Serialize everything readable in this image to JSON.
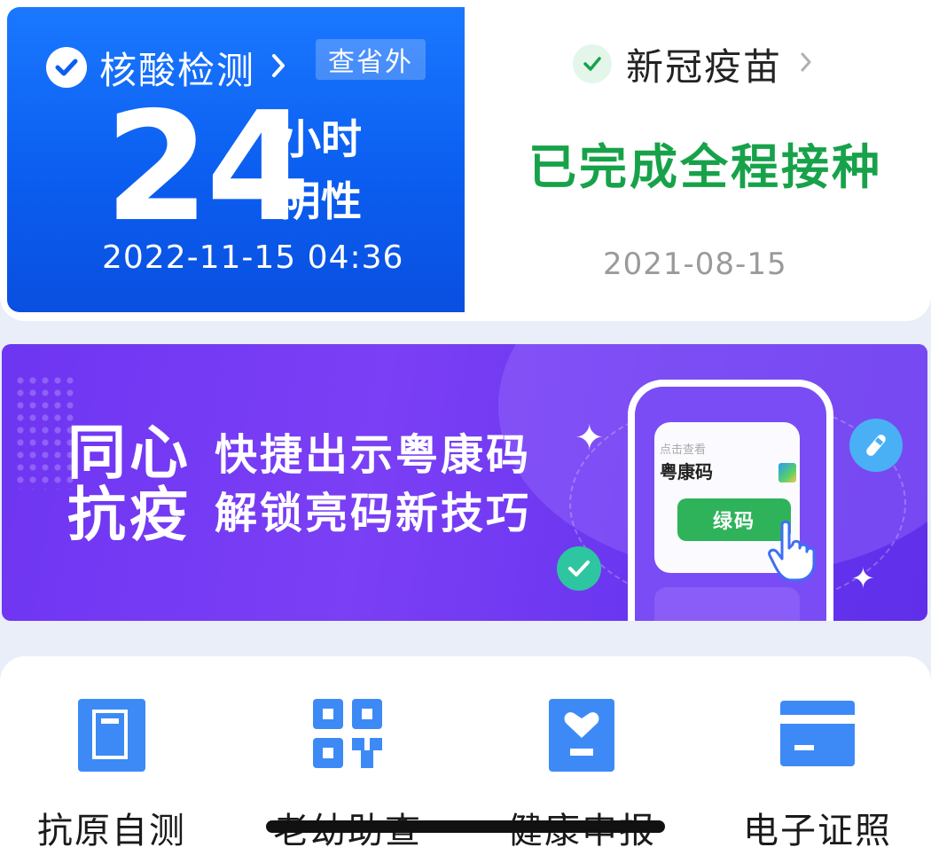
{
  "nucleic": {
    "title": "核酸检测",
    "tag": "查省外",
    "hours": "24",
    "unit": "小时",
    "result": "阴性",
    "datetime": "2022-11-15 04:36"
  },
  "vaccine": {
    "title": "新冠疫苗",
    "status": "已完成全程接种",
    "date": "2021-08-15"
  },
  "banner": {
    "big_line1": "同心",
    "big_line2": "抗疫",
    "line1": "快捷出示粤康码",
    "line2": "解锁亮码新技巧",
    "phone_small": "点击查看",
    "phone_title": "粤康码",
    "phone_button": "绿码"
  },
  "services": [
    {
      "label": "抗原自测",
      "icon": "book-icon"
    },
    {
      "label": "老幼助查",
      "icon": "qr-code-icon"
    },
    {
      "label": "健康申报",
      "icon": "heart-report-icon"
    },
    {
      "label": "电子证照",
      "icon": "card-icon"
    }
  ],
  "colors": {
    "nucleic_blue": "#0b5ef0",
    "vaccine_green": "#17a24a",
    "banner_purple": "#6e35f2",
    "icon_blue": "#3d8af7"
  }
}
